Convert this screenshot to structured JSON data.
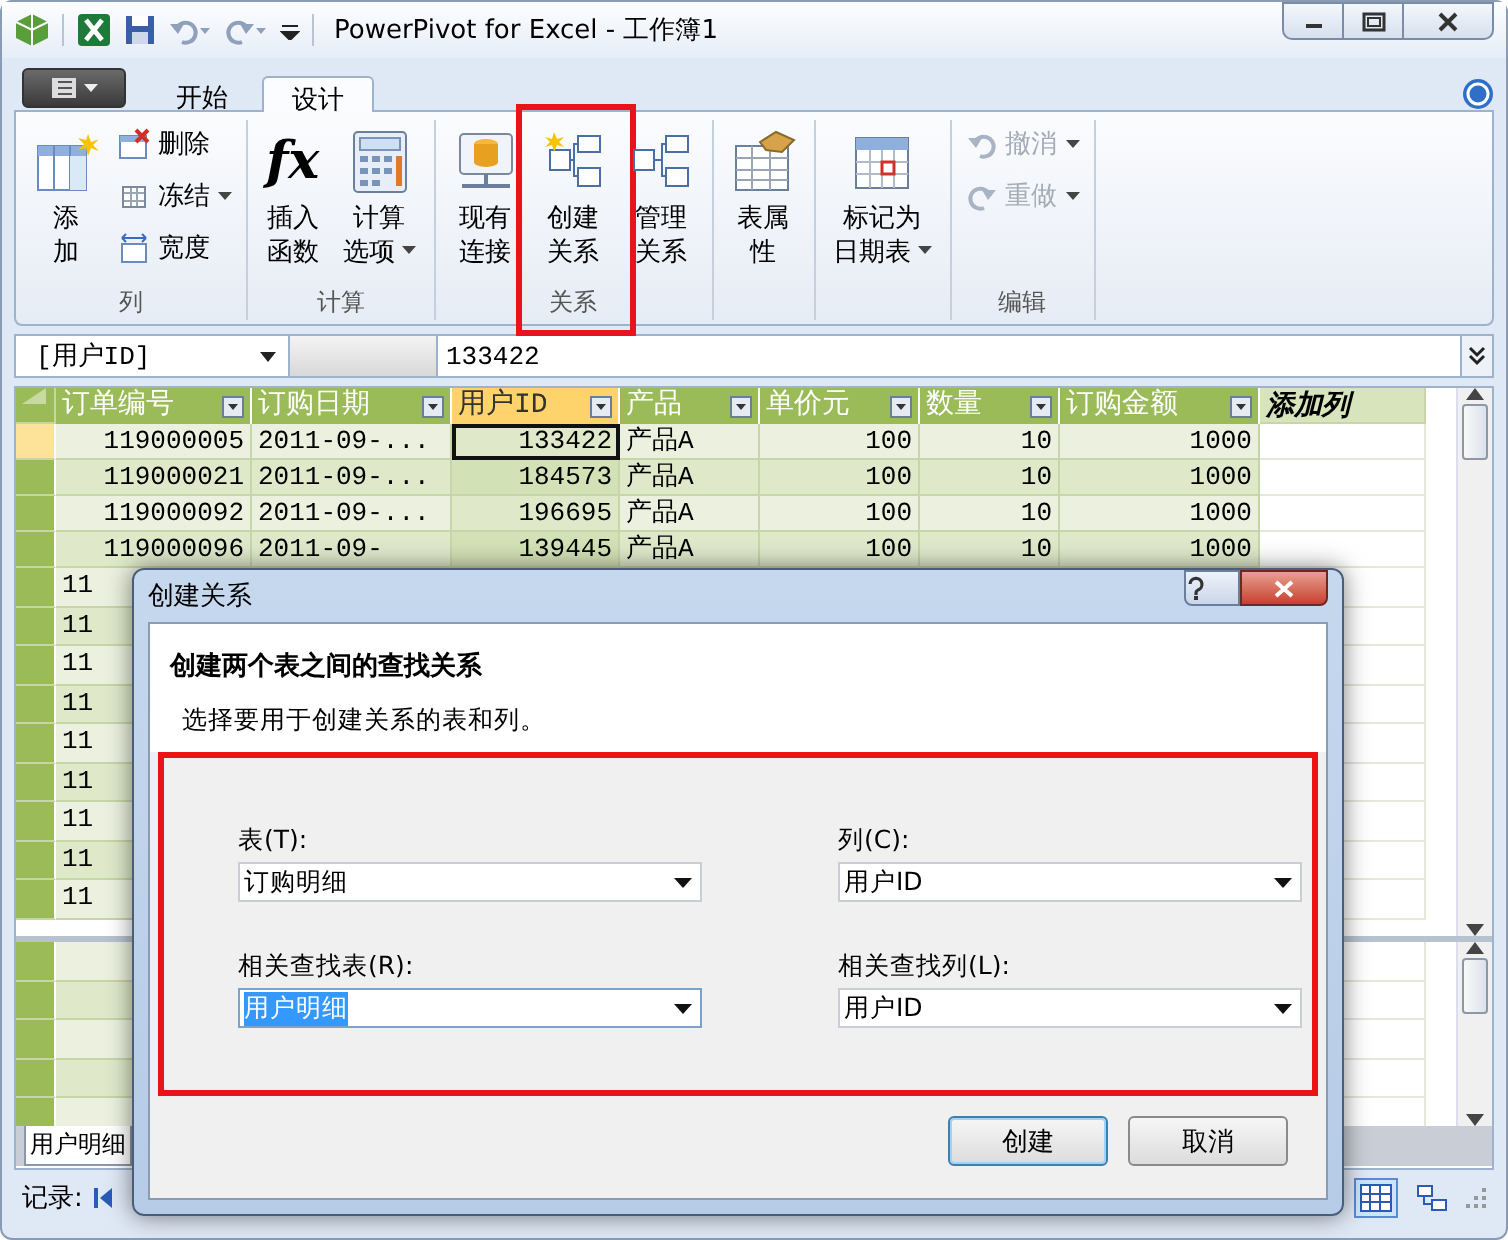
{
  "window": {
    "title": "PowerPivot for Excel - 工作簿1"
  },
  "tabs": [
    {
      "label": "开始",
      "selected": false
    },
    {
      "label": "设计",
      "selected": true
    }
  ],
  "ribbon": {
    "groups": [
      {
        "label": "列",
        "buttons": [
          {
            "kind": "large",
            "lines": [
              "添",
              "加"
            ],
            "dropdown": false,
            "disabled": false,
            "highlighted": false
          },
          {
            "kind": "small",
            "lines": [
              "删除"
            ],
            "dropdown": false,
            "disabled": false,
            "highlighted": false
          },
          {
            "kind": "small",
            "lines": [
              "冻结"
            ],
            "dropdown": true,
            "disabled": false,
            "highlighted": false
          },
          {
            "kind": "small",
            "lines": [
              "宽度"
            ],
            "dropdown": false,
            "disabled": false,
            "highlighted": false
          }
        ]
      },
      {
        "label": "计算",
        "buttons": [
          {
            "kind": "large",
            "glyph": "fx",
            "lines": [
              "插入",
              "函数"
            ],
            "dropdown": false,
            "disabled": false,
            "highlighted": false
          },
          {
            "kind": "large",
            "lines": [
              "计算",
              "选项"
            ],
            "dropdown": true,
            "disabled": false,
            "highlighted": false
          }
        ]
      },
      {
        "label": "关系",
        "buttons": [
          {
            "kind": "large",
            "lines": [
              "现有",
              "连接"
            ],
            "dropdown": false,
            "disabled": false,
            "highlighted": false
          },
          {
            "kind": "large",
            "lines": [
              "创建",
              "关系"
            ],
            "dropdown": false,
            "disabled": false,
            "highlighted": true
          },
          {
            "kind": "large",
            "lines": [
              "管理",
              "关系"
            ],
            "dropdown": false,
            "disabled": false,
            "highlighted": false
          }
        ]
      },
      {
        "buttons": [
          {
            "kind": "large",
            "lines": [
              "表属",
              "性"
            ],
            "dropdown": false,
            "disabled": false,
            "highlighted": false
          }
        ]
      },
      {
        "buttons": [
          {
            "kind": "large",
            "lines": [
              "标记为",
              "日期表"
            ],
            "dropdown": true,
            "disabled": false,
            "highlighted": false
          }
        ]
      },
      {
        "label": "编辑",
        "buttons": [
          {
            "kind": "small",
            "lines": [
              "撤消"
            ],
            "dropdown": true,
            "disabled": true,
            "highlighted": false
          },
          {
            "kind": "small",
            "lines": [
              "重做"
            ],
            "dropdown": true,
            "disabled": true,
            "highlighted": false
          }
        ]
      }
    ]
  },
  "formula_bar": {
    "name_box": "[用户ID]",
    "value": "133422"
  },
  "grid": {
    "columns": [
      {
        "label": "订单编号",
        "selected": false
      },
      {
        "label": "订购日期",
        "selected": false
      },
      {
        "label": "用户ID",
        "selected": true
      },
      {
        "label": "产品",
        "selected": false
      },
      {
        "label": "单价元",
        "selected": false
      },
      {
        "label": "数量",
        "selected": false
      },
      {
        "label": "订购金额",
        "selected": false
      }
    ],
    "add_column": "添加列",
    "rows": [
      {
        "selected": true,
        "cells": [
          "119000005",
          "2011-09-...",
          "133422",
          "产品A",
          "100",
          "10",
          "1000"
        ]
      },
      {
        "selected": false,
        "cells": [
          "119000021",
          "2011-09-...",
          "184573",
          "产品A",
          "100",
          "10",
          "1000"
        ]
      },
      {
        "selected": false,
        "cells": [
          "119000092",
          "2011-09-...",
          "196695",
          "产品A",
          "100",
          "10",
          "1000"
        ]
      },
      {
        "selected": false,
        "cells": [
          "119000096",
          "2011-09-",
          "139445",
          "产品A",
          "100",
          "10",
          "1000"
        ]
      },
      {
        "selected": false,
        "cells": [
          "11"
        ]
      },
      {
        "selected": false,
        "cells": [
          "11"
        ]
      },
      {
        "selected": false,
        "cells": [
          "11"
        ]
      },
      {
        "selected": false,
        "cells": [
          "11"
        ]
      },
      {
        "selected": false,
        "cells": [
          "11"
        ]
      },
      {
        "selected": false,
        "cells": [
          "11"
        ]
      },
      {
        "selected": false,
        "cells": [
          "11"
        ]
      },
      {
        "selected": false,
        "cells": [
          "11"
        ]
      },
      {
        "selected": false,
        "cells": [
          "11"
        ]
      }
    ]
  },
  "sheet_tabs": [
    {
      "label": "用户明细",
      "selected": true
    }
  ],
  "status_bar": {
    "label": "记录:",
    "views": [
      {
        "kind": "grid",
        "selected": true
      },
      {
        "kind": "diagram",
        "selected": false
      }
    ]
  },
  "dialog": {
    "title": "创建关系",
    "heading": "创建两个表之间的查找关系",
    "description": "选择要用于创建关系的表和列。",
    "highlighted": true,
    "fields": [
      {
        "label": "表(T):",
        "value": "订购明细",
        "focused": false
      },
      {
        "label": "列(C):",
        "value": "用户ID",
        "focused": false
      },
      {
        "label": "相关查找表(R):",
        "value": "用户明细",
        "focused": true
      },
      {
        "label": "相关查找列(L):",
        "value": "用户ID",
        "focused": false
      }
    ],
    "buttons": [
      {
        "label": "创建",
        "default": true
      },
      {
        "label": "取消",
        "default": false
      }
    ]
  }
}
